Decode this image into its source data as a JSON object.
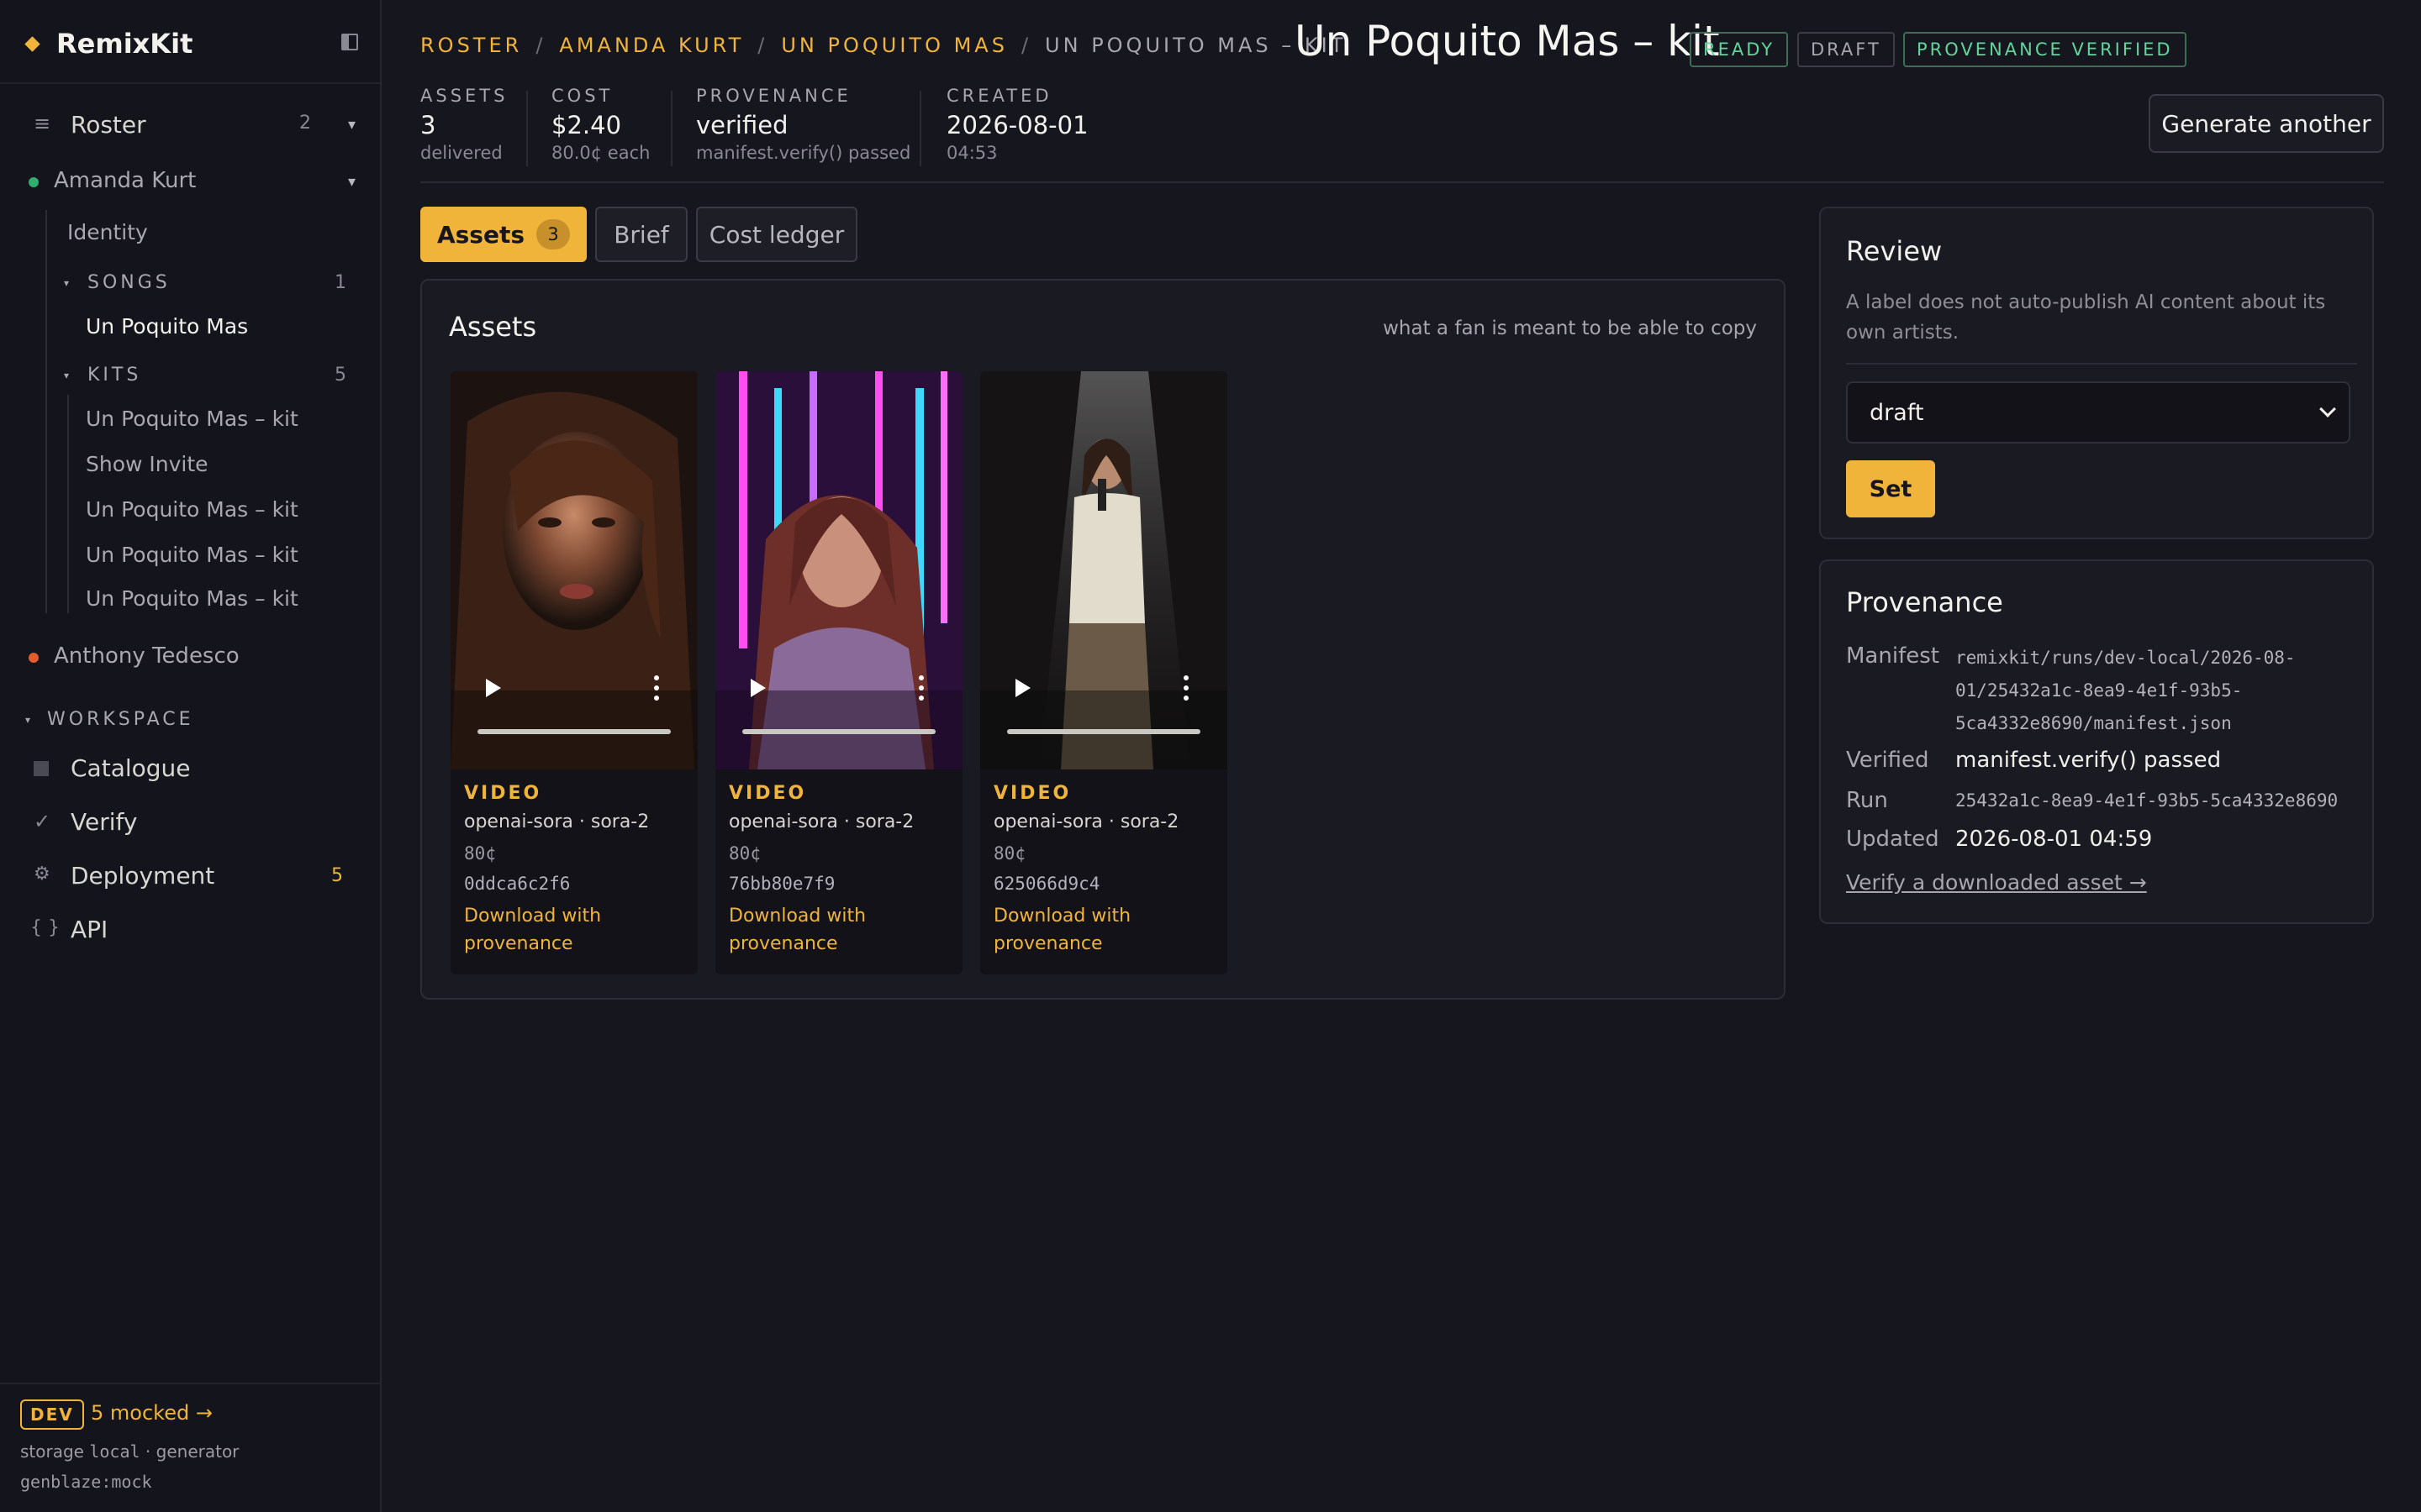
{
  "app": {
    "name": "RemixKit"
  },
  "sidebar": {
    "roster": {
      "label": "Roster",
      "count": "2"
    },
    "artists": [
      {
        "name": "Amanda Kurt",
        "status_color": "#2fae6e"
      },
      {
        "name": "Anthony Tedesco",
        "status_color": "#e35d2a"
      }
    ],
    "identity_label": "Identity",
    "songs": {
      "label": "SONGS",
      "count": "1",
      "items": [
        "Un Poquito Mas"
      ]
    },
    "kits": {
      "label": "KITS",
      "count": "5",
      "items": [
        "Un Poquito Mas – kit",
        "Show Invite",
        "Un Poquito Mas – kit",
        "Un Poquito Mas – kit",
        "Un Poquito Mas – kit"
      ]
    },
    "workspace": {
      "label": "WORKSPACE",
      "items": [
        {
          "label": "Catalogue",
          "icon": "square-icon"
        },
        {
          "label": "Verify",
          "icon": "check-icon"
        },
        {
          "label": "Deployment",
          "icon": "gear-icon",
          "count": "5"
        },
        {
          "label": "API",
          "icon": "braces-icon"
        }
      ]
    },
    "dev": {
      "badge": "DEV",
      "mocked": "5 mocked →",
      "storage_label": "storage",
      "storage_value": "local",
      "generator_label": "· generator",
      "generator_value": "genblaze:mock"
    }
  },
  "header": {
    "breadcrumb": [
      "ROSTER",
      "AMANDA KURT",
      "UN POQUITO MAS"
    ],
    "separator": "/",
    "current": "UN POQUITO MAS – KIT",
    "title": "Un Poquito Mas – kit",
    "badges": [
      "READY",
      "DRAFT",
      "PROVENANCE VERIFIED"
    ],
    "stats": [
      {
        "key": "ASSETS",
        "value": "3",
        "sub": "delivered"
      },
      {
        "key": "COST",
        "value": "$2.40",
        "sub": "80.0¢ each"
      },
      {
        "key": "PROVENANCE",
        "value": "verified",
        "sub": "manifest.verify() passed"
      },
      {
        "key": "CREATED",
        "value": "2026-08-01",
        "sub": "04:53"
      }
    ],
    "action_button": "Generate another"
  },
  "tabs": [
    {
      "label": "Assets",
      "count": "3",
      "active": true
    },
    {
      "label": "Brief"
    },
    {
      "label": "Cost ledger"
    }
  ],
  "assets_panel": {
    "title": "Assets",
    "hint": "what a fan is meant to be able to copy",
    "cards": [
      {
        "type": "VIDEO",
        "model": "openai-sora · sora-2",
        "cost": "80¢",
        "hash": "0ddca6c2f6",
        "download": "Download with provenance"
      },
      {
        "type": "VIDEO",
        "model": "openai-sora · sora-2",
        "cost": "80¢",
        "hash": "76bb80e7f9",
        "download": "Download with provenance"
      },
      {
        "type": "VIDEO",
        "model": "openai-sora · sora-2",
        "cost": "80¢",
        "hash": "625066d9c4",
        "download": "Download with provenance"
      }
    ]
  },
  "review": {
    "title": "Review",
    "description": "A label does not auto-publish AI content about its own artists.",
    "select_value": "draft",
    "set_button": "Set"
  },
  "provenance": {
    "title": "Provenance",
    "manifest_label": "Manifest",
    "manifest_lines": [
      "remixkit/runs/dev-local/2026-08-",
      "01/25432a1c-8ea9-4e1f-93b5-",
      "5ca4332e8690/manifest.json"
    ],
    "verified_label": "Verified",
    "verified_value": "manifest.verify() passed",
    "run_label": "Run",
    "run_value": "25432a1c-8ea9-4e1f-93b5-5ca4332e8690",
    "updated_label": "Updated",
    "updated_value": "2026-08-01 04:59",
    "link": "Verify a downloaded asset →"
  },
  "colors": {
    "accent": "#f0b43a",
    "success": "#62d49c",
    "background": "#16161f"
  }
}
